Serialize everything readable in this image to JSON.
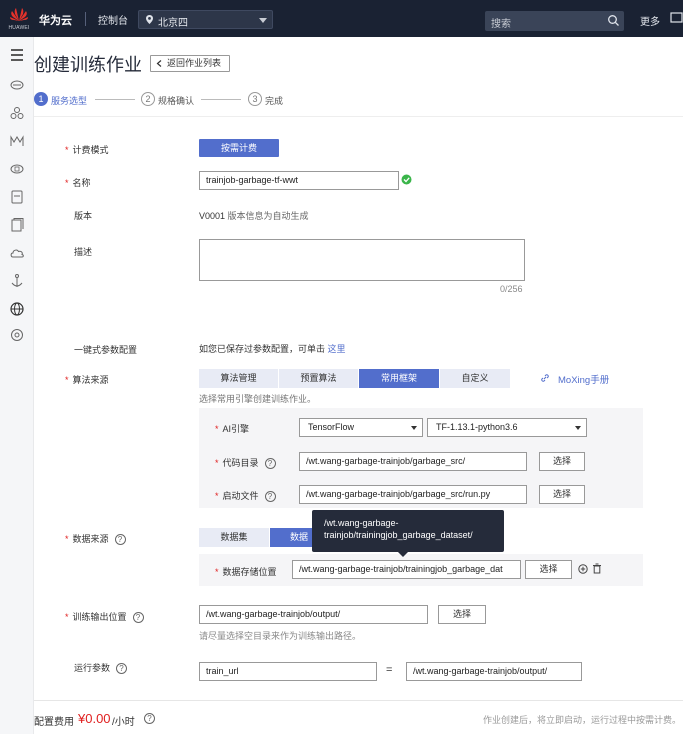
{
  "topbar": {
    "logo_text": "HUAWEI",
    "brand": "华为云",
    "console": "控制台",
    "region": "北京四",
    "search_placeholder": "搜索",
    "more": "更多"
  },
  "page": {
    "title": "创建训练作业",
    "back_label": "返回作业列表"
  },
  "steps": [
    {
      "num": "1",
      "label": "服务选型",
      "state": "active"
    },
    {
      "num": "2",
      "label": "规格确认",
      "state": "idle"
    },
    {
      "num": "3",
      "label": "完成",
      "state": "idle"
    }
  ],
  "form": {
    "billing": {
      "label": "计费模式",
      "value": "按需计费"
    },
    "name": {
      "label": "名称",
      "value": "trainjob-garbage-tf-wwt"
    },
    "version": {
      "label": "版本",
      "value": "V0001",
      "note": "版本信息为自动生成"
    },
    "description": {
      "label": "描述",
      "counter": "0/256"
    },
    "oneclick": {
      "label": "一键式参数配置",
      "text": "如您已保存过参数配置，可单击",
      "link": "这里"
    },
    "algo_source": {
      "label": "算法来源",
      "tabs": [
        "算法管理",
        "预置算法",
        "常用框架",
        "自定义"
      ],
      "active_tab": "常用框架",
      "moxing_link": "MoXing手册",
      "hint": "选择常用引擎创建训练作业。",
      "engine_label": "AI引擎",
      "engine": "TensorFlow",
      "engine_version": "TF-1.13.1-python3.6",
      "code_dir_label": "代码目录",
      "code_dir": "/wt.wang-garbage-trainjob/garbage_src/",
      "boot_file_label": "启动文件",
      "boot_file": "/wt.wang-garbage-trainjob/garbage_src/run.py",
      "select_btn": "选择"
    },
    "data_source": {
      "label": "数据来源",
      "tabs": [
        "数据集",
        "数据"
      ],
      "tooltip_line1": "/wt.wang-garbage-",
      "tooltip_line2": "trainjob/trainingjob_garbage_dataset/",
      "storage_label": "数据存储位置",
      "storage": "/wt.wang-garbage-trainjob/trainingjob_garbage_dat",
      "select_btn": "选择"
    },
    "output": {
      "label": "训练输出位置",
      "value": "/wt.wang-garbage-trainjob/output/",
      "select_btn": "选择",
      "hint": "请尽量选择空目录来作为训练输出路径。"
    },
    "run_params": {
      "label": "运行参数",
      "key": "train_url",
      "eq": "=",
      "value": "/wt.wang-garbage-trainjob/output/"
    }
  },
  "footer": {
    "price_label": "配置费用",
    "price": "¥0.00",
    "unit": "/小时",
    "note": "作业创建后，将立即启动，运行过程中按需计费。"
  },
  "colors": {
    "primary": "#526ecc",
    "topbar": "#1a2233",
    "required": "#e02020",
    "success": "#3ab54a"
  }
}
